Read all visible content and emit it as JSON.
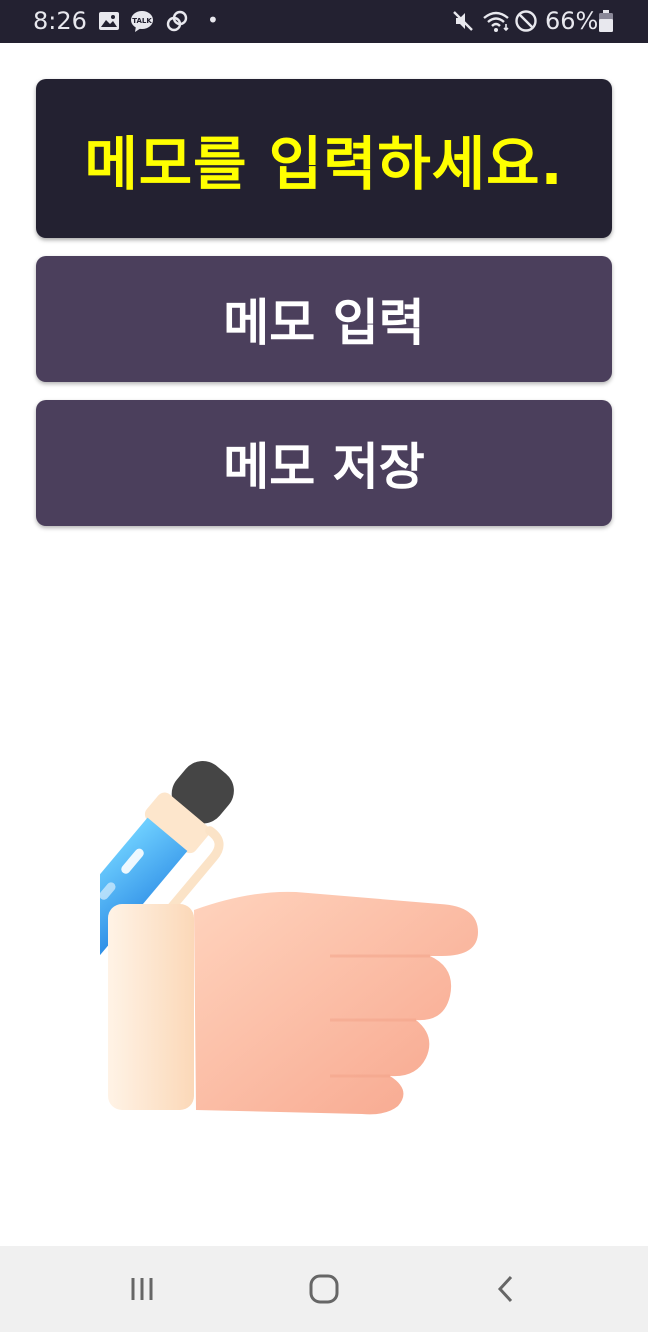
{
  "status_bar": {
    "time": "8:26",
    "battery": "66%",
    "icons": [
      "gallery-icon",
      "kakaotalk-icon",
      "link-icon",
      "dot-indicator",
      "mute-icon",
      "wifi-icon",
      "do-not-disturb-icon",
      "battery-icon"
    ]
  },
  "memo_display": {
    "text": "메모를 입력하세요.",
    "text_color": "#ffff00",
    "background": "#232131"
  },
  "buttons": {
    "input_label": "메모 입력",
    "save_label": "메모 저장",
    "background": "#4b3f5c"
  },
  "illustration": {
    "icon": "hand-writing-pen-illustration"
  },
  "nav_bar": {
    "icons": [
      "recent-apps-icon",
      "home-icon",
      "back-icon"
    ]
  }
}
